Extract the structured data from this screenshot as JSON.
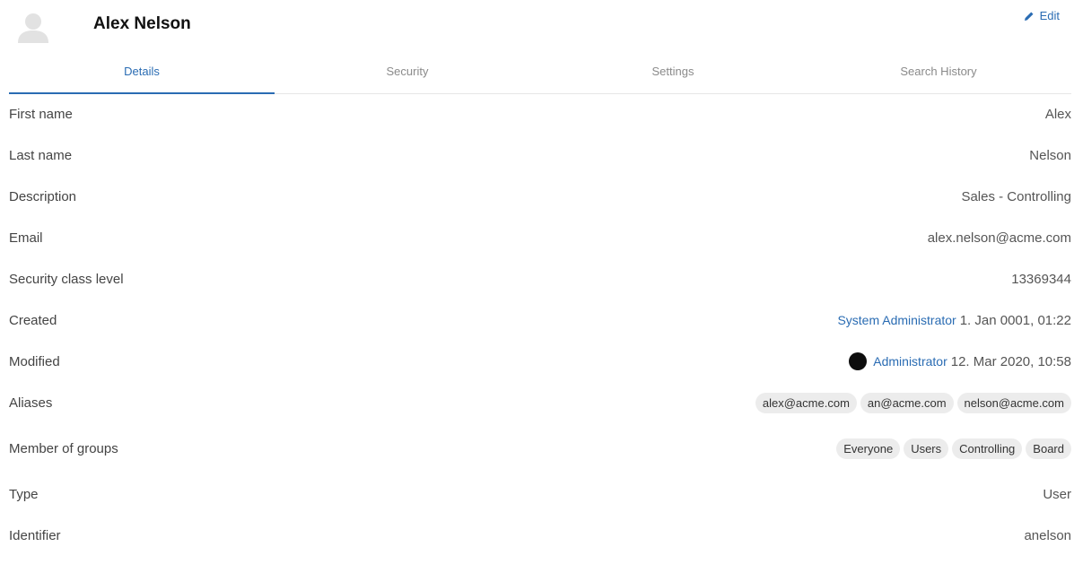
{
  "header": {
    "user_name": "Alex Nelson",
    "edit_label": "Edit",
    "accent_color": "#2a6cb3"
  },
  "tabs": [
    {
      "label": "Details",
      "active": true
    },
    {
      "label": "Security",
      "active": false
    },
    {
      "label": "Settings",
      "active": false
    },
    {
      "label": "Search History",
      "active": false
    }
  ],
  "details": {
    "first_name": {
      "label": "First name",
      "value": "Alex"
    },
    "last_name": {
      "label": "Last name",
      "value": "Nelson"
    },
    "description": {
      "label": "Description",
      "value": "Sales - Controlling"
    },
    "email": {
      "label": "Email",
      "value": "alex.nelson@acme.com"
    },
    "security_class": {
      "label": "Security class level",
      "value": "13369344"
    },
    "created": {
      "label": "Created",
      "by": "System Administrator",
      "date": "1. Jan 0001, 01:22"
    },
    "modified": {
      "label": "Modified",
      "by": "Administrator",
      "date": "12. Mar 2020, 10:58"
    },
    "aliases": {
      "label": "Aliases",
      "items": [
        "alex@acme.com",
        "an@acme.com",
        "nelson@acme.com"
      ]
    },
    "groups": {
      "label": "Member of groups",
      "items": [
        "Everyone",
        "Users",
        "Controlling",
        "Board"
      ]
    },
    "type": {
      "label": "Type",
      "value": "User"
    },
    "identifier": {
      "label": "Identifier",
      "value": "anelson"
    }
  }
}
